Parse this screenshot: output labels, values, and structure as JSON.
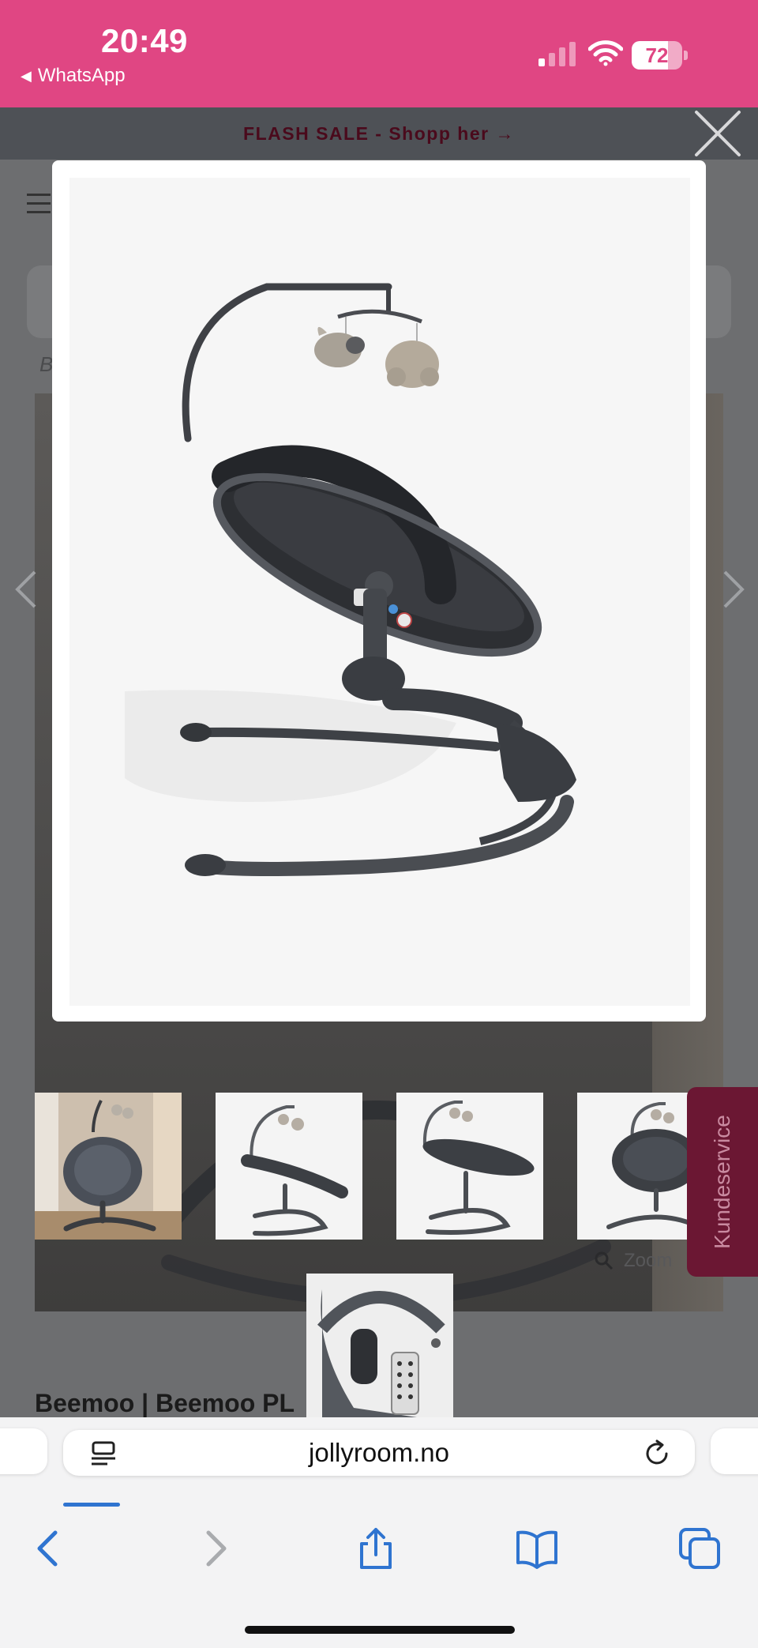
{
  "status_bar": {
    "time": "20:49",
    "back_app": "WhatsApp",
    "battery": "72",
    "battery_level": 0.72
  },
  "banner": {
    "text": "FLASH SALE - Shopp her →"
  },
  "breadcrumb": {
    "text": "B"
  },
  "gallery": {
    "zoom_label": "Zoom"
  },
  "customer_service": {
    "label": "Kundeservice"
  },
  "product": {
    "title": "Beemoo | Beemoo PL"
  },
  "browser": {
    "url": "jollyroom.no",
    "load_progress": 0.09
  },
  "icons": {
    "close": "close-icon",
    "menu": "menu-icon",
    "prev": "chevron-left-icon",
    "next": "chevron-right-icon",
    "zoom": "magnifier-icon",
    "reader": "reader-icon",
    "reload": "reload-icon",
    "back": "back-arrow-icon",
    "forward": "forward-arrow-icon",
    "share": "share-icon",
    "bookmarks": "book-icon",
    "tabs": "tabs-icon"
  },
  "colors": {
    "status_bar": "#e04683",
    "flash_bar": "#4e5156",
    "accent_tab": "#6b1733",
    "progress": "#2f74d0"
  }
}
